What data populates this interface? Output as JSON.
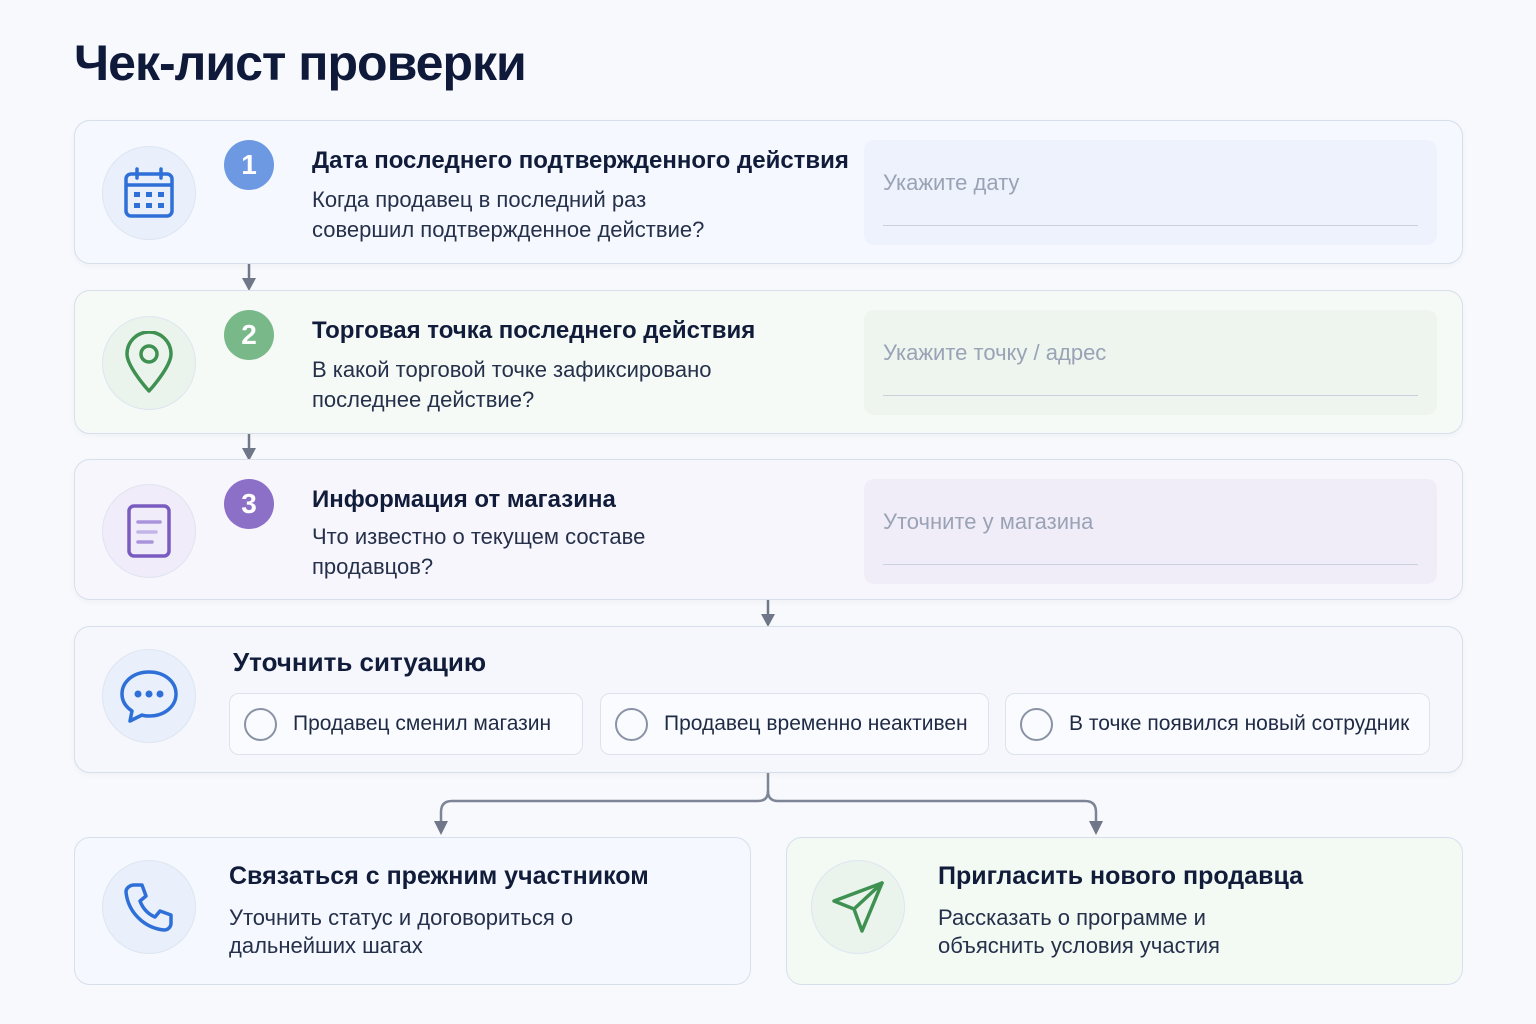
{
  "page": {
    "title": "Чек-лист проверки"
  },
  "steps": [
    {
      "number": "1",
      "title": "Дата последнего подтвержденного действия",
      "description": "Когда продавец в последний раз совершил подтвержденное действие?",
      "placeholder": "Укажите дату",
      "icon": "calendar-icon",
      "accent": "#6d98e2"
    },
    {
      "number": "2",
      "title": "Торговая точка последнего действия",
      "description": "В какой торговой точке зафиксировано последнее действие?",
      "placeholder": "Укажите точку / адрес",
      "icon": "location-pin-icon",
      "accent": "#79b889"
    },
    {
      "number": "3",
      "title": "Информация от магазина",
      "description": "Что известно о текущем составе продавцов?",
      "placeholder": "Уточните у магазина",
      "icon": "document-icon",
      "accent": "#8c70c8"
    }
  ],
  "situation": {
    "title": "Уточнить ситуацию",
    "icon": "chat-bubble-icon",
    "options": [
      "Продавец сменил магазин",
      "Продавец временно неактивен",
      "В точке появился новый сотрудник"
    ]
  },
  "actions": [
    {
      "title": "Связаться с прежним участником",
      "description": "Уточнить статус и договориться о дальнейших шагах",
      "icon": "phone-icon",
      "accent": "#2f6fd6"
    },
    {
      "title": "Пригласить нового продавца",
      "description": "Рассказать о программе и объяснить условия участия",
      "icon": "send-icon",
      "accent": "#3e9150"
    }
  ]
}
